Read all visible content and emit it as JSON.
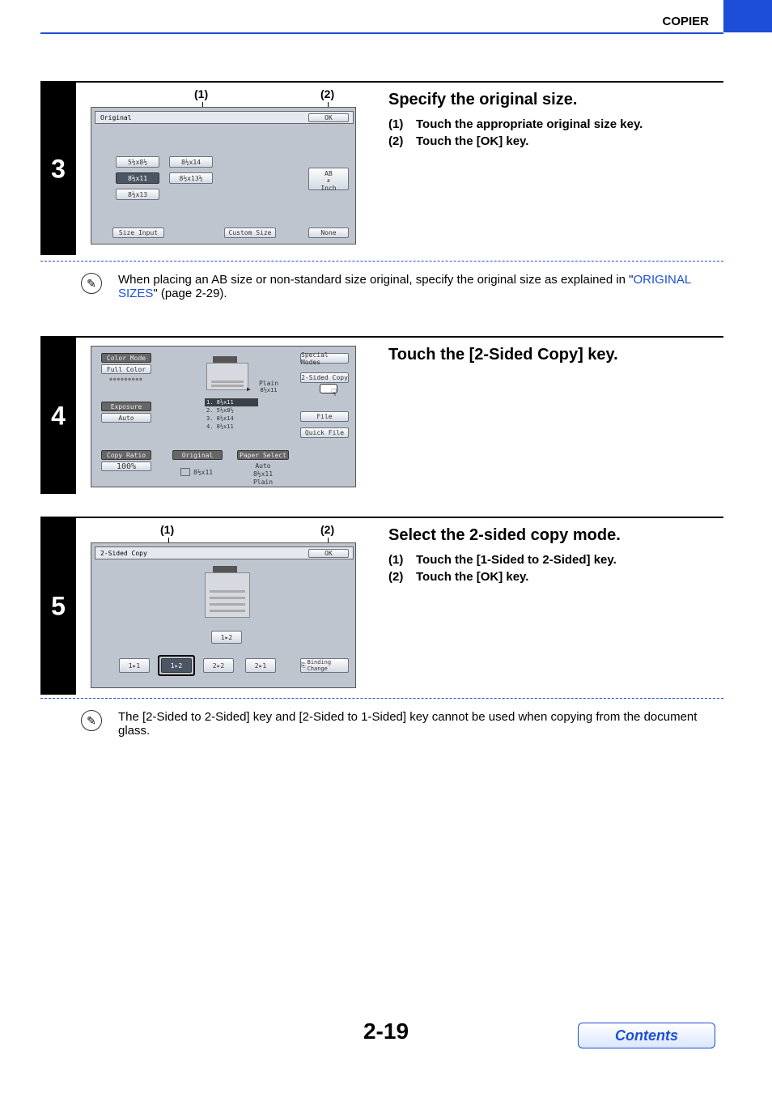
{
  "header": {
    "title": "COPIER"
  },
  "step3": {
    "num": "3",
    "callout1": "(1)",
    "callout2": "(2)",
    "panel": {
      "title": "Original",
      "ok": "OK",
      "btn1": "5½x8½",
      "btn2": "8½x14",
      "btn3": "8½x11",
      "btn4": "8½x13½",
      "btn5": "8½x13",
      "ab": "AB",
      "inch": "Inch",
      "size_input": "Size Input",
      "custom_size": "Custom Size",
      "none": "None"
    },
    "instr_title": "Specify the original size.",
    "instr1_num": "(1)",
    "instr1": "Touch the appropriate original size key.",
    "instr2_num": "(2)",
    "instr2": "Touch the [OK] key.",
    "note_pre": "When placing an AB size or non-standard size original, specify the original size as explained in \"",
    "note_link": "ORIGINAL SIZES",
    "note_post": "\" (page 2-29)."
  },
  "step4": {
    "num": "4",
    "panel": {
      "color_mode": "Color Mode",
      "full_color": "Full Color",
      "exposure": "Exposure",
      "auto": "Auto",
      "copy_ratio": "Copy Ratio",
      "ratio": "100%",
      "original": "Original",
      "orig_size": "8½x11",
      "paper_select": "Paper Select",
      "ps_auto": "Auto",
      "ps_size": "8½x11",
      "ps_type": "Plain",
      "special_modes": "Special Modes",
      "two_sided": "2-Sided Copy",
      "file": "File",
      "quick_file": "Quick File",
      "plain": "Plain",
      "plain_sz": "8½x11",
      "tray1": "1.  8½x11",
      "tray2": "2.  5½x8½",
      "tray3": "3.  8½x14",
      "tray4": "4.  8½x11"
    },
    "instr_title": "Touch the [2-Sided Copy] key."
  },
  "step5": {
    "num": "5",
    "callout1": "(1)",
    "callout2": "(2)",
    "panel": {
      "title": "2-Sided Copy",
      "ok": "OK",
      "b1": "1▸1",
      "b2": "1▸2",
      "b3": "2▸2",
      "b4": "2▸1",
      "center": "1▸2",
      "binding": "Binding Change"
    },
    "instr_title": "Select the 2-sided copy mode.",
    "instr1_num": "(1)",
    "instr1": "Touch the [1-Sided to 2-Sided] key.",
    "instr2_num": "(2)",
    "instr2": "Touch the [OK] key.",
    "note": "The [2-Sided to 2-Sided] key and [2-Sided to 1-Sided] key cannot be used when copying from the document glass."
  },
  "footer": {
    "page_num": "2-19",
    "contents": "Contents"
  }
}
